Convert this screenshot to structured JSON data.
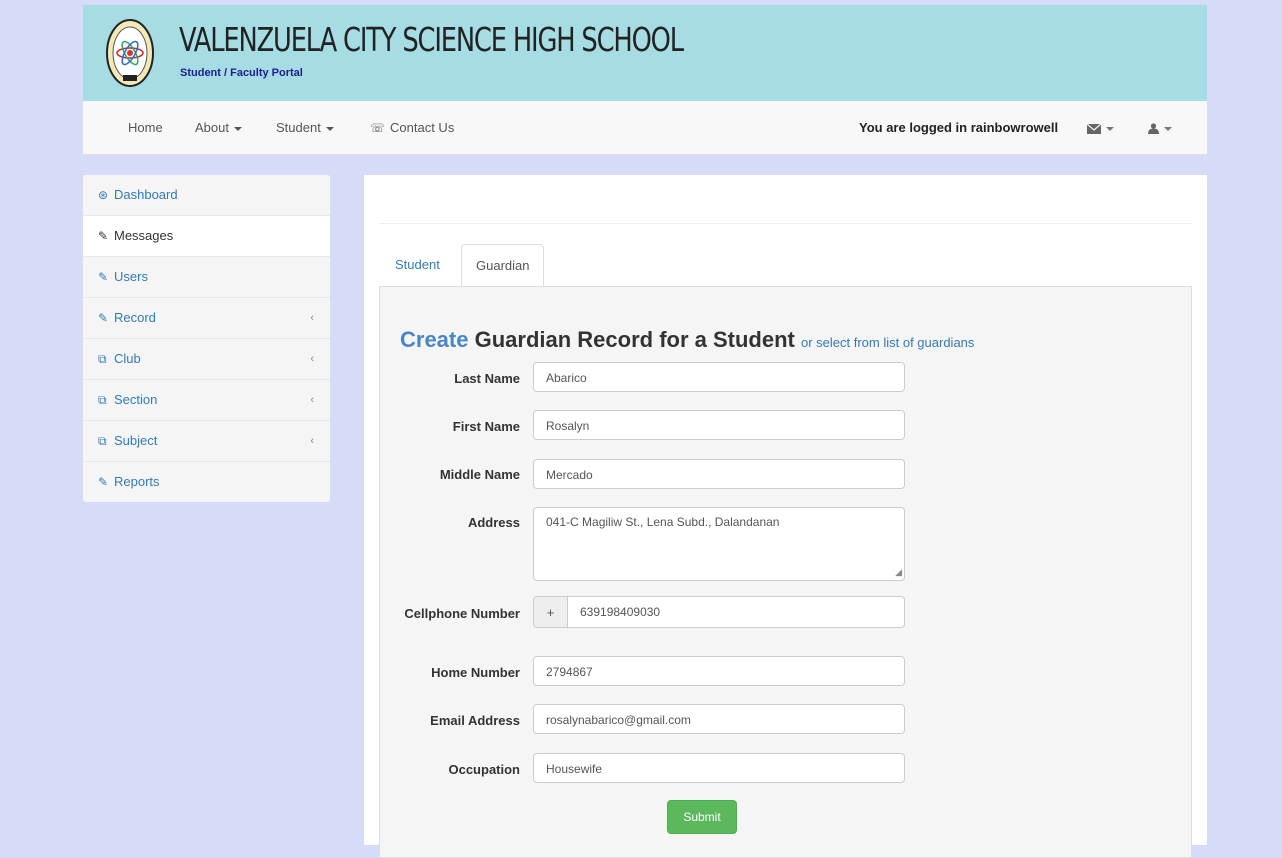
{
  "header": {
    "school_name": "VALENZUELA CITY SCIENCE HIGH SCHOOL",
    "portal": "Student / Faculty Portal"
  },
  "nav": {
    "home": "Home",
    "about": "About",
    "student": "Student",
    "contact": "Contact Us",
    "logged_in": "You are logged in rainbowrowell"
  },
  "sidebar": {
    "items": [
      {
        "label": "Dashboard",
        "icon": "dashboard-icon"
      },
      {
        "label": "Messages",
        "icon": "edit-icon"
      },
      {
        "label": "Users",
        "icon": "edit-icon"
      },
      {
        "label": "Record",
        "icon": "edit-icon"
      },
      {
        "label": "Club",
        "icon": "copy-icon"
      },
      {
        "label": "Section",
        "icon": "copy-icon"
      },
      {
        "label": "Subject",
        "icon": "copy-icon"
      },
      {
        "label": "Reports",
        "icon": "edit-icon"
      }
    ]
  },
  "tabs": {
    "student": "Student",
    "guardian": "Guardian"
  },
  "form": {
    "title_create": "Create",
    "title_rest": "Guardian Record for a Student",
    "title_link": "or select from list of guardians",
    "labels": {
      "last_name": "Last Name",
      "first_name": "First Name",
      "middle_name": "Middle Name",
      "address": "Address",
      "cellphone": "Cellphone Number",
      "home_number": "Home Number",
      "email": "Email Address",
      "occupation": "Occupation"
    },
    "values": {
      "last_name": "Abarico",
      "first_name": "Rosalyn",
      "middle_name": "Mercado",
      "address": "041-C Magiliw St., Lena Subd., Dalandanan",
      "cell_prefix": "+",
      "cellphone": "639198409030",
      "home_number": "2794867",
      "email": "rosalynabarico@gmail.com",
      "occupation": "Housewife"
    },
    "submit": "Submit"
  }
}
